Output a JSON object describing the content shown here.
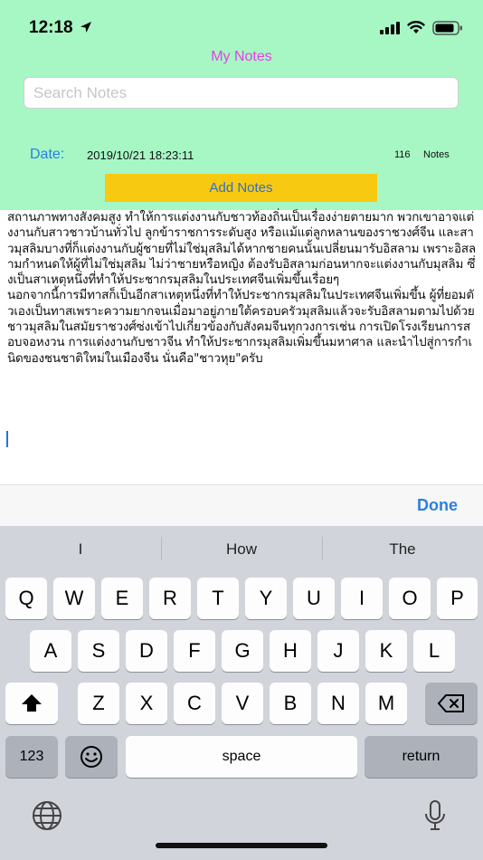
{
  "status_bar": {
    "time": "12:18",
    "icons": [
      "location-arrow-icon",
      "signal-icon",
      "wifi-icon",
      "battery-icon"
    ]
  },
  "header": {
    "title": "My Notes",
    "search": {
      "placeholder": "Search Notes",
      "value": ""
    },
    "date_label": "Date:",
    "date_value": "2019/10/21 18:23:11",
    "notes_count": "116",
    "notes_unit": "Notes",
    "add_button_label": "Add Notes"
  },
  "note": {
    "text": "สถานภาพทางสังคมสูง ทำให้การแต่งงานกับชาวท้องถิ่นเป็นเรื่องง่ายตายมาก พวกเขาอาจแต่งงานกับสาวชาวบ้านทั่วไป ลูกข้าราชการระดับสูง หรือแม้แต่ลูกหลานของราชวงศ์จีน และสาวมุสลิมบางที่ก็แต่งงานกับผู้ชายที่ไม่ใช่มุสลิมได้หากชายคนนั้นเปลี่ยนมารับอิสลาม เพราะอิสลามกำหนดให้ผู้ที่ไม่ใช่มุสลิม ไม่ว่าชายหรือหญิง ต้องรับอิสลามก่อนหากจะแต่งงานกับมุสลิม ซึ่งเป็นสาเหตุหนึ่งที่ทำให้ประชากรมุสลิมในประเทศจีนเพิ่มขึ้นเรื่อยๆ\nนอกจากนี้การมีทาสก็เป็นอีกสาเหตุหนึ่งที่ทำให้ประชากรมุสลิมในประเทศจีนเพิ่มขึ้น ผู้ที่ยอมตัวเองเป็นทาสเพราะความยากจนเมื่อมาอยู่ภายใต้ครอบครัวมุสลิมแล้วจะรับอิสลามตามไปด้วย ชาวมุสลิมในสมัยราชวงศ์ซ่งเข้าไปเกี่ยวข้องกับสังคมจีนทุกวงการเช่น การเปิดโรงเรียนการสอบจอหงวน การแต่งงานกับชาวจีน ทำให้ประชากรมุสลิมเพิ่มขึ้นมหาศาล และนำไปสู่การกำเนิดของชนชาติใหม่ในเมืองจีน นั่นคือ\"ชาวหุย\"ครับ"
  },
  "accessory": {
    "done_label": "Done"
  },
  "keyboard": {
    "suggestions": [
      "I",
      "How",
      "The"
    ],
    "row1": [
      "Q",
      "W",
      "E",
      "R",
      "T",
      "Y",
      "U",
      "I",
      "O",
      "P"
    ],
    "row2": [
      "A",
      "S",
      "D",
      "F",
      "G",
      "H",
      "J",
      "K",
      "L"
    ],
    "row3": [
      "Z",
      "X",
      "C",
      "V",
      "B",
      "N",
      "M"
    ],
    "numbers_label": "123",
    "space_label": "space",
    "return_label": "return",
    "icons": [
      "shift-icon",
      "backspace-icon",
      "emoji-icon",
      "globe-icon",
      "microphone-icon"
    ]
  },
  "colors": {
    "header_bg": "#a6f7c4",
    "title": "#e83ee8",
    "accent_blue": "#2b7fe0",
    "add_button_bg": "#f8c911",
    "keyboard_bg": "#d1d4da"
  }
}
